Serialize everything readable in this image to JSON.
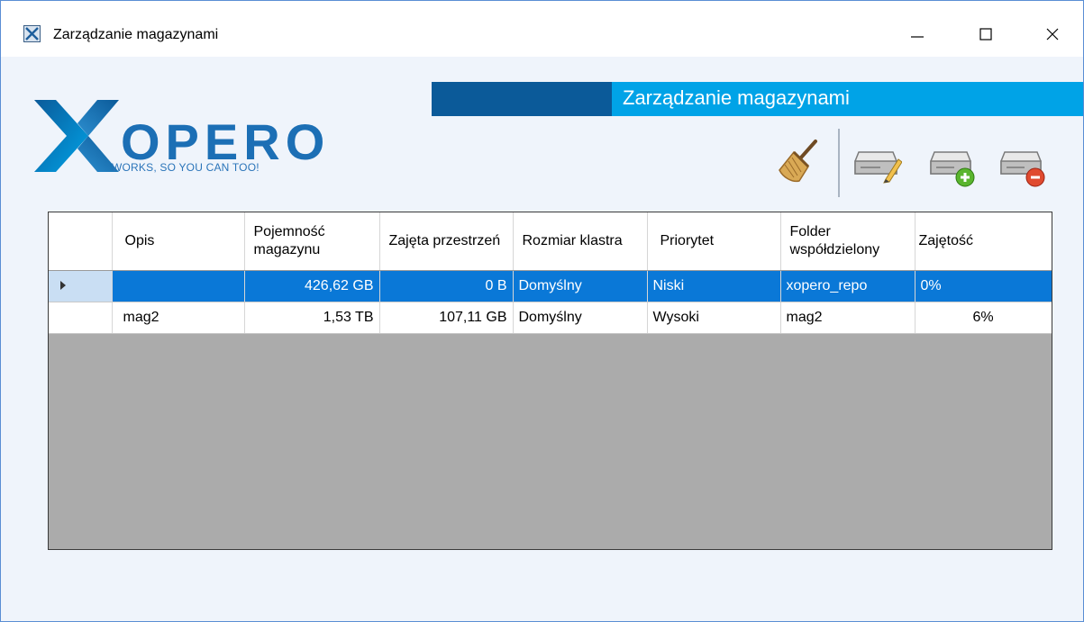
{
  "window": {
    "title": "Zarządzanie magazynami",
    "controls": {
      "minimize": "—",
      "maximize": "☐",
      "close": "✕"
    }
  },
  "brand": {
    "logo_text": "XOPERO",
    "tagline": "WORKS, SO YOU CAN TOO!",
    "colors": {
      "dark_blue": "#0b5a99",
      "light_blue": "#00a3e7",
      "selection": "#0a78d7"
    }
  },
  "header": {
    "title": "Zarządzanie magazynami"
  },
  "toolbar": {
    "items": [
      {
        "name": "clean-button",
        "icon": "broom-icon"
      },
      {
        "name": "edit-repository-button",
        "icon": "drive-edit-icon"
      },
      {
        "name": "add-repository-button",
        "icon": "drive-add-icon"
      },
      {
        "name": "remove-repository-button",
        "icon": "drive-remove-icon"
      }
    ]
  },
  "grid": {
    "columns": [
      {
        "label": ""
      },
      {
        "label": "Opis"
      },
      {
        "label": "Pojemność magazynu"
      },
      {
        "label": "Zajęta przestrzeń"
      },
      {
        "label": "Rozmiar klastra"
      },
      {
        "label": "Priorytet"
      },
      {
        "label": "Folder współdzielony"
      },
      {
        "label": "Zajętość"
      }
    ],
    "rows": [
      {
        "selected": true,
        "opis": "",
        "pojemnosc": "426,62 GB",
        "zajeta": "0 B",
        "klaster": "Domyślny",
        "priorytet": "Niski",
        "folder": "xopero_repo",
        "zajetosc": "0%"
      },
      {
        "selected": false,
        "opis": "mag2",
        "pojemnosc": "1,53 TB",
        "zajeta": "107,11 GB",
        "klaster": "Domyślny",
        "priorytet": "Wysoki",
        "folder": "mag2",
        "zajetosc": "6%"
      }
    ]
  }
}
